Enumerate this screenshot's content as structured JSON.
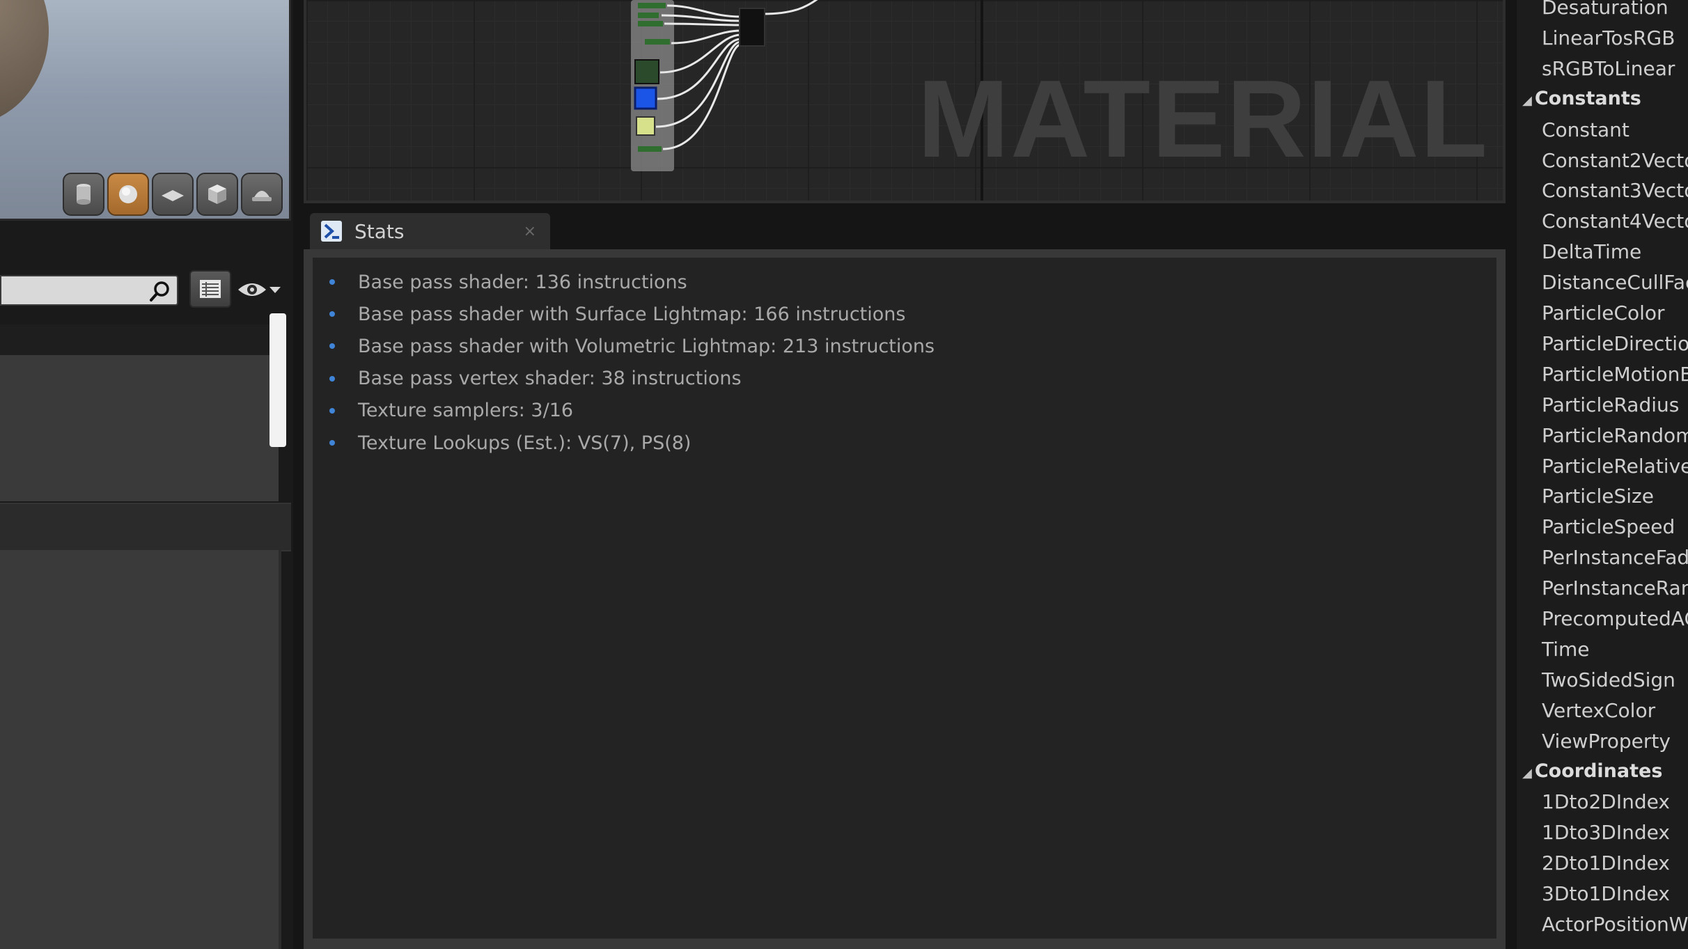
{
  "graph": {
    "watermark": "MATERIAL"
  },
  "stats_tab": {
    "label": "Stats",
    "close": "×"
  },
  "stats": [
    "Base pass shader: 136 instructions",
    "Base pass shader with Surface Lightmap: 166 instructions",
    "Base pass shader with Volumetric Lightmap: 213 instructions",
    "Base pass vertex shader: 38 instructions",
    "Texture samplers: 3/16",
    "Texture Lookups (Est.): VS(7), PS(8)"
  ],
  "palette": {
    "entries": [
      {
        "kind": "item",
        "text": "Desaturation"
      },
      {
        "kind": "item",
        "text": "LinearTosRGB"
      },
      {
        "kind": "item",
        "text": "sRGBToLinear"
      },
      {
        "kind": "category",
        "text": "Constants"
      },
      {
        "kind": "item",
        "text": "Constant"
      },
      {
        "kind": "item",
        "text": "Constant2Vecto"
      },
      {
        "kind": "item",
        "text": "Constant3Vecto"
      },
      {
        "kind": "item",
        "text": "Constant4Vecto"
      },
      {
        "kind": "item",
        "text": "DeltaTime"
      },
      {
        "kind": "item",
        "text": "DistanceCullFac"
      },
      {
        "kind": "item",
        "text": "ParticleColor"
      },
      {
        "kind": "item",
        "text": "ParticleDirectio"
      },
      {
        "kind": "item",
        "text": "ParticleMotionB"
      },
      {
        "kind": "item",
        "text": "ParticleRadius"
      },
      {
        "kind": "item",
        "text": "ParticleRandom"
      },
      {
        "kind": "item",
        "text": "ParticleRelative"
      },
      {
        "kind": "item",
        "text": "ParticleSize"
      },
      {
        "kind": "item",
        "text": "ParticleSpeed"
      },
      {
        "kind": "item",
        "text": "PerInstanceFad"
      },
      {
        "kind": "item",
        "text": "PerInstanceRan"
      },
      {
        "kind": "item",
        "text": "PrecomputedAC"
      },
      {
        "kind": "item",
        "text": "Time"
      },
      {
        "kind": "item",
        "text": "TwoSidedSign"
      },
      {
        "kind": "item",
        "text": "VertexColor"
      },
      {
        "kind": "item",
        "text": "ViewProperty"
      },
      {
        "kind": "category",
        "text": "Coordinates"
      },
      {
        "kind": "item",
        "text": "1Dto2DIndex"
      },
      {
        "kind": "item",
        "text": "1Dto3DIndex"
      },
      {
        "kind": "item",
        "text": "2Dto1DIndex"
      },
      {
        "kind": "item",
        "text": "3Dto1DIndex"
      },
      {
        "kind": "item",
        "text": "ActorPositionWS"
      }
    ]
  },
  "icons": {
    "preview_buttons": [
      "cylinder-icon",
      "sphere-icon",
      "plane-icon",
      "cube-icon",
      "custom-mesh-icon"
    ],
    "active_preview": "sphere-icon"
  },
  "colors": {
    "bullet": "#3f84d6",
    "active_button": "#c98a45"
  }
}
